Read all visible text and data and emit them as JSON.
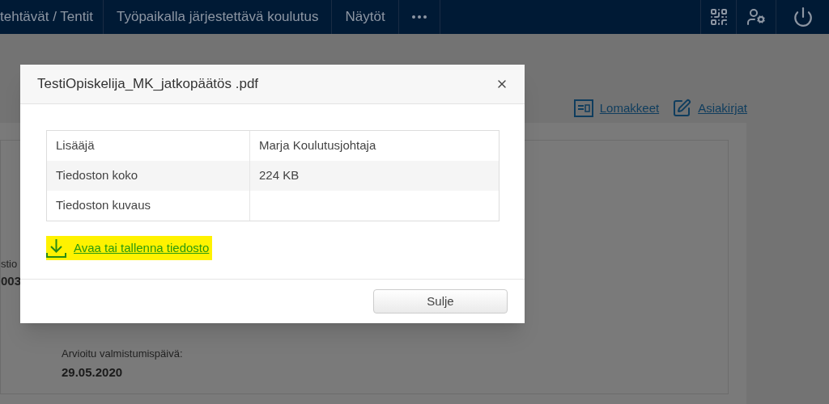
{
  "nav": {
    "items": [
      "tehtävät / Tentit",
      "Työpaikalla järjestettävä koulutus",
      "Näytöt"
    ]
  },
  "page": {
    "links": [
      "Lomakkeet",
      "Asiakirjat"
    ],
    "fragments": [
      "stio",
      "003"
    ],
    "fields": [
      {
        "label": "Arvioitu valmistumispäivä:",
        "value": "29.05.2020"
      }
    ]
  },
  "dialog": {
    "title": "TestiOpiskelija_MK_jatkopäätös .pdf",
    "rows": [
      {
        "label": "Lisääjä",
        "value": "Marja Koulutusjohtaja"
      },
      {
        "label": "Tiedoston koko",
        "value": "224 KB"
      },
      {
        "label": "Tiedoston kuvaus",
        "value": ""
      }
    ],
    "download_link": "Avaa tai tallenna tiedosto",
    "highlighted": true,
    "buttons": [
      "Sulje"
    ]
  }
}
